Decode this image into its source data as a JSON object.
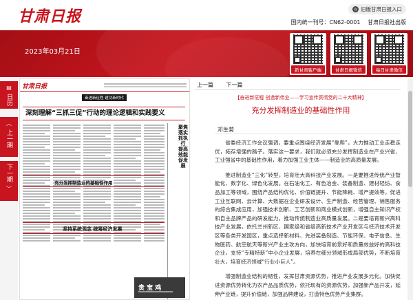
{
  "header": {
    "logo": "甘肃日报",
    "old_version_label": "旧版甘肃日报入口",
    "issn": "国内统一刊号：CN62-0001",
    "publisher": "甘肃日报社出版"
  },
  "banner": {
    "date": "2023年03月21日",
    "qr_codes": [
      {
        "label": "新甘肃客户端",
        "icon": "qr-code-icon"
      },
      {
        "label": "甘肃日报微信",
        "icon": "qr-code-icon"
      },
      {
        "label": "每日甘肃微信",
        "icon": "qr-code-icon"
      }
    ]
  },
  "sidenav": {
    "calendar": "日历",
    "prev_week": "上一期",
    "next_week": "下一期"
  },
  "paper": {
    "logo": "甘肃日报",
    "kicker": "奋进新征程 建功新时代",
    "main_title": "深刻理解“三抓三促”行动的理论逻辑和实践要义",
    "vertical_title": "聚焦落实抓执行 提高效能促发展",
    "article_title": "充分发挥制造业的基础性作用",
    "bottom_title": "坚持系统观念 统筹经济发展",
    "ad_text": "贵 宝 鸡"
  },
  "article": {
    "prev": "上一篇",
    "next": "下一篇",
    "kicker": "【奋进新征程 创造新伟业——学习宣传贯彻党的二十大精神】",
    "headline": "充分发挥制造业的基础性作用",
    "author": "邓生菊",
    "paragraphs": [
      "省委经济工作会议强调，要重点围绕经济发展“靠爬”，大力推动工业走稳走优，拓存增强的路子。落实这一要求，我们就必须充分发挥制造业在产业兴省、工业强省中的基础性作用，着力加强工业主体——制造业的高质量发展。",
      "推进制造业“三化”转型，培育壮大高科技产业发展。一是要推进传统产业智能化、数字化、绿色化发展。在石油化工、有色冶金、装备制造、建材轻纺、食品加工等领域，围绕产品结构优化、价值链提升、节能降耗、增产提效等，促进工业互联网、云计算、大数据在企业研发设计、生产制造、经营管理、销售服务的综合集成应用，加强技术创新、工艺创新和商业模式创新，增强自主知识产权和自主品牌产品的研发能力，推动传统制造业高质量发展。二是要培育新兴高科技产业发展。依托兰州新区、国家级和省级高新技术产业开发区与经济技术开发区等各类开发园区，重点选择新材料、先进装备制造、节能环保、电子信息、生物医药、航空航天等新兴产业主攻方向，加快培育前景好和质量效益好的高科技企业，支持“专精特新”中小企业发展，培养在细分领域形成局部优势，不断培育壮大，培育经济领域“行业小巨人”。",
      "增强制造业结构的韧性，发挥甘肃资源优势，推进产业发展多元化。加快促进资源优势转化为农产品品质优势，依托现有的资源优势，加强新产品开发，延伸产业链，提升价值链，加强品牌建设，打造特色优势产业集群。"
    ]
  }
}
